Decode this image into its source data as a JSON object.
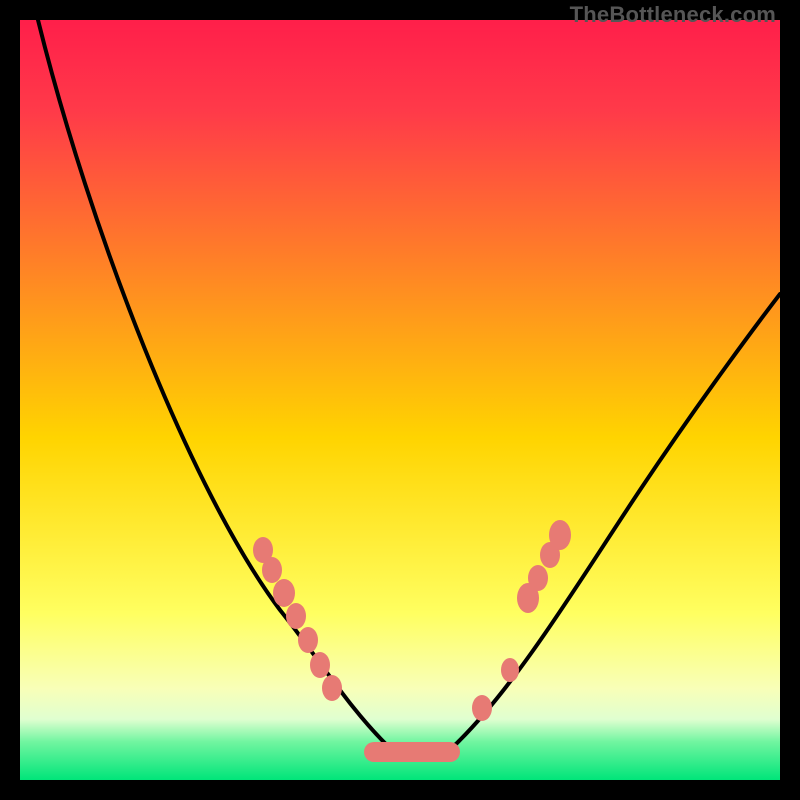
{
  "watermark": "TheBottleneck.com",
  "colors": {
    "gradient_top": "#ff1f4a",
    "gradient_mid1": "#ff7a2a",
    "gradient_mid2": "#ffd400",
    "gradient_mid3": "#ffff60",
    "gradient_bottom": "#00e57a",
    "curve": "#000000",
    "marker": "#e77a74",
    "frame": "#000000"
  },
  "chart_data": {
    "type": "line",
    "title": "",
    "xlabel": "",
    "ylabel": "",
    "xlim": [
      0,
      100
    ],
    "ylim": [
      0,
      100
    ],
    "grid": false,
    "legend": false,
    "series": [
      {
        "name": "bottleneck-curve",
        "x": [
          2,
          5,
          10,
          15,
          20,
          25,
          30,
          34,
          38,
          42,
          44,
          46,
          48,
          50,
          52,
          54,
          56,
          60,
          65,
          70,
          75,
          80,
          85,
          90,
          95,
          100
        ],
        "y": [
          100,
          94,
          84,
          74,
          64,
          54,
          44,
          35,
          27,
          19,
          14,
          10,
          6,
          3,
          1,
          2,
          5,
          11,
          20,
          29,
          38,
          46,
          54,
          62,
          69,
          60
        ]
      }
    ],
    "markers_left": [
      {
        "x": 32,
        "y": 34
      },
      {
        "x": 33,
        "y": 31
      },
      {
        "x": 35,
        "y": 26
      },
      {
        "x": 36,
        "y": 23
      },
      {
        "x": 38,
        "y": 19
      },
      {
        "x": 40,
        "y": 15
      },
      {
        "x": 41,
        "y": 13
      }
    ],
    "markers_bottom": [
      {
        "x": 46,
        "y": 4
      },
      {
        "x": 48,
        "y": 3
      },
      {
        "x": 50,
        "y": 3
      },
      {
        "x": 52,
        "y": 3
      },
      {
        "x": 54,
        "y": 3
      },
      {
        "x": 56,
        "y": 4
      }
    ],
    "markers_right": [
      {
        "x": 60,
        "y": 12
      },
      {
        "x": 64,
        "y": 21
      },
      {
        "x": 65,
        "y": 23
      },
      {
        "x": 67,
        "y": 27
      },
      {
        "x": 68,
        "y": 30
      },
      {
        "x": 70,
        "y": 35
      }
    ]
  }
}
